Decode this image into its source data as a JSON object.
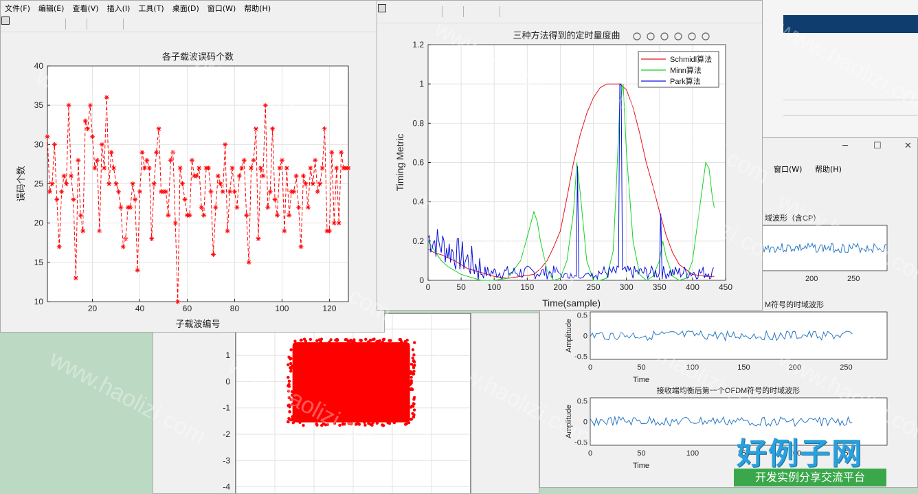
{
  "fig_errors": {
    "menu": [
      "文件(F)",
      "编辑(E)",
      "查看(V)",
      "插入(I)",
      "工具(T)",
      "桌面(D)",
      "窗口(W)",
      "帮助(H)"
    ],
    "chart_data": {
      "type": "line",
      "title": "各子载波误码个数",
      "xlabel": "子载波编号",
      "ylabel": "误码个数",
      "xlim": [
        1,
        128
      ],
      "ylim": [
        10,
        40
      ],
      "xticks": [
        20,
        40,
        60,
        80,
        100,
        120
      ],
      "yticks": [
        10,
        15,
        20,
        25,
        30,
        35,
        40
      ],
      "grid": true,
      "series": [
        {
          "style": "dashed-asterisk",
          "color": "#ff0000",
          "values": [
            31,
            24,
            25,
            30,
            23,
            17,
            24,
            26,
            25,
            35,
            26,
            23,
            13,
            28,
            21,
            19,
            33,
            32,
            35,
            31,
            27,
            28,
            19,
            30,
            27,
            36,
            25,
            29,
            27,
            25,
            24,
            22,
            17,
            18,
            22,
            22,
            25,
            23,
            14,
            24,
            29,
            27,
            28,
            27,
            18,
            25,
            29,
            32,
            24,
            24,
            24,
            21,
            28,
            29,
            20,
            10,
            27,
            25,
            23,
            21,
            21,
            28,
            26,
            26,
            27,
            22,
            21,
            27,
            27,
            24,
            16,
            22,
            26,
            25,
            24,
            30,
            19,
            24,
            27,
            24,
            22,
            26,
            27,
            28,
            21,
            15,
            27,
            28,
            32,
            18,
            27,
            26,
            35,
            22,
            24,
            32,
            23,
            21,
            27,
            28,
            19,
            27,
            21,
            24,
            24,
            26,
            22,
            17,
            26,
            25,
            22,
            27,
            25,
            28,
            24,
            25,
            27,
            32,
            19,
            19,
            29,
            20,
            27,
            20,
            29,
            27,
            27,
            27
          ]
        }
      ]
    }
  },
  "fig_timing": {
    "chart_data": {
      "type": "line",
      "title": "三种方法得到的定时量度曲",
      "xlabel": "Time(sample)",
      "ylabel": "Timing Metric",
      "xlim": [
        0,
        450
      ],
      "ylim": [
        0,
        1.2
      ],
      "xticks": [
        0,
        50,
        100,
        150,
        200,
        250,
        300,
        350,
        400,
        450
      ],
      "yticks": [
        0,
        0.2,
        0.4,
        0.6,
        0.8,
        1,
        1.2
      ],
      "ytick_labels": [
        "0",
        "0.2",
        "0.4",
        "0.6",
        "0.8",
        "1",
        "1.2"
      ],
      "grid": true,
      "legend_placement": "top-right",
      "series": [
        {
          "name": "Schmidl算法",
          "color": "#e8101a",
          "x": [
            0,
            10,
            20,
            40,
            60,
            80,
            100,
            120,
            140,
            160,
            170,
            180,
            190,
            200,
            210,
            220,
            230,
            240,
            250,
            260,
            270,
            280,
            290,
            300,
            310,
            320,
            330,
            340,
            350,
            360,
            370,
            380,
            400,
            420,
            433
          ],
          "y": [
            0.16,
            0.14,
            0.13,
            0.1,
            0.06,
            0.04,
            0.02,
            0.01,
            0.02,
            0.03,
            0.06,
            0.1,
            0.17,
            0.25,
            0.42,
            0.6,
            0.74,
            0.85,
            0.93,
            0.98,
            1,
            1,
            1,
            0.97,
            0.88,
            0.75,
            0.6,
            0.48,
            0.35,
            0.23,
            0.14,
            0.08,
            0.03,
            0.02,
            0.02
          ]
        },
        {
          "name": "Minn算法",
          "color": "#13d41f",
          "x": [
            0,
            10,
            20,
            30,
            40,
            50,
            60,
            70,
            80,
            100,
            120,
            140,
            150,
            160,
            165,
            170,
            180,
            190,
            200,
            210,
            220,
            225,
            230,
            240,
            250,
            260,
            270,
            280,
            285,
            290,
            295,
            300,
            310,
            320,
            330,
            340,
            350,
            355,
            360,
            370,
            380,
            390,
            400,
            410,
            420,
            425,
            430,
            433
          ],
          "y": [
            0.2,
            0.15,
            0.1,
            0.07,
            0.05,
            0.03,
            0.02,
            0.01,
            0,
            0,
            0.01,
            0.1,
            0.22,
            0.35,
            0.3,
            0.2,
            0.05,
            0,
            0.01,
            0.1,
            0.35,
            0.6,
            0.45,
            0.1,
            0,
            0,
            0.01,
            0.15,
            0.5,
            0.9,
            1,
            0.65,
            0.2,
            0.03,
            0,
            0.02,
            0.1,
            0.2,
            0.12,
            0.02,
            0,
            0.01,
            0.1,
            0.35,
            0.6,
            0.57,
            0.42,
            0.37
          ]
        },
        {
          "name": "Park算法",
          "color": "#0a12d8",
          "noise": true
        }
      ]
    }
  },
  "fig_constellation": {
    "chart_data": {
      "type": "scatter",
      "ytick_labels": [
        "2",
        "1",
        "0",
        "-1",
        "-2",
        "-3",
        "-4"
      ],
      "ylim": [
        -4.3,
        2.6
      ],
      "xlim": [
        -3,
        3
      ],
      "color": "#ff0000"
    }
  },
  "fig_waveform": {
    "menu": [
      "窗口(W)",
      "帮助(H)"
    ],
    "panels": [
      {
        "title": "域波形（含CP）",
        "title_fragment": true,
        "xlabel": "",
        "ylabel": "",
        "xticks": [
          200,
          250
        ],
        "xtick_labels": [
          "200",
          "250"
        ]
      },
      {
        "title": "M符号的时域波形",
        "title_fragment": true,
        "xlabel": "Time",
        "ylabel": "Amplitude",
        "yticks": [
          "0.5",
          "0",
          "-0.5"
        ],
        "xtick_labels": [
          "0",
          "50",
          "100",
          "150",
          "200",
          "250"
        ]
      },
      {
        "title": "接收端均衡后第一个OFDM符号的时域波形",
        "xlabel": "Time",
        "ylabel": "Amplitude",
        "yticks": [
          "0.5",
          "0",
          "-0.5"
        ],
        "xtick_labels": [
          "0",
          "50",
          "100",
          "150",
          "200",
          "250"
        ]
      }
    ]
  },
  "watermark": "www.haolizi.com",
  "logo": {
    "main": "好例子网",
    "sub": "开发实例分享交流平台"
  }
}
